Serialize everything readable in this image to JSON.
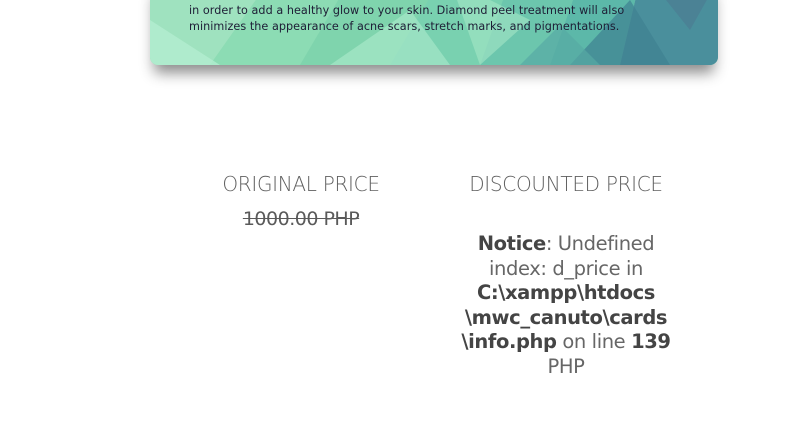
{
  "banner": {
    "line1": "in order to add a healthy glow to your skin. Diamond peel treatment will also",
    "line2": "minimizes the appearance of acne scars, stretch marks, and pigmentations."
  },
  "prices": {
    "original": {
      "heading": "ORIGINAL PRICE",
      "value": "1000.00 PHP"
    },
    "discounted": {
      "heading": "DISCOUNTED PRICE",
      "notice_label": "Notice",
      "notice_msg_a": ": Undefined",
      "notice_msg_b": "index: d_price in",
      "path_a": "C:\\xampp\\htdocs",
      "path_b": "\\mwc_canuto\\cards",
      "path_c": "\\info.php",
      "on_line_text": " on line ",
      "line_number": "139",
      "currency": "PHP"
    }
  },
  "colors": {
    "banner_text": "#1d1d35",
    "heading_text": "#606060",
    "notice_bold": "#444444"
  }
}
